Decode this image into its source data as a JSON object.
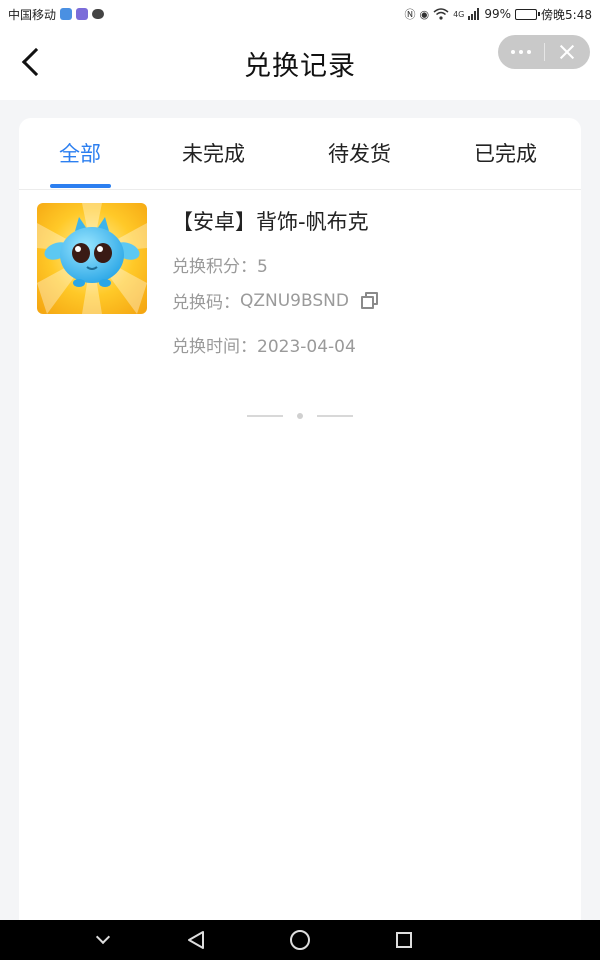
{
  "status_bar": {
    "carrier": "中国移动",
    "battery": "99%",
    "battery_level": 0.99,
    "time": "傍晚5:48",
    "network": "4G",
    "icons": [
      "app-notification-icon",
      "app-notification-icon",
      "chat-icon",
      "nfc-icon",
      "eye-icon",
      "wifi-icon",
      "signal-icon",
      "battery-icon"
    ],
    "colors": {
      "app_icon_1": "#4a90e2",
      "app_icon_2": "#7b6cd9",
      "battery_fill": "#2bb34a"
    }
  },
  "header": {
    "title": "兑换记录",
    "back_icon": "chevron-left-icon",
    "capsule": {
      "more_icon": "more-dots-icon",
      "close_icon": "close-icon"
    }
  },
  "tabs": [
    {
      "label": "全部",
      "active": true
    },
    {
      "label": "未完成",
      "active": false
    },
    {
      "label": "待发货",
      "active": false
    },
    {
      "label": "已完成",
      "active": false
    }
  ],
  "accent_color": "#2c7ff0",
  "records": [
    {
      "title": "【安卓】背饰-帆布克",
      "points_label": "兑换积分：",
      "points_value": "5",
      "code_label": "兑换码：",
      "code_value": "QZNU9BSND",
      "time_label": "兑换时间：",
      "time_value": "2023-04-04",
      "image": "blue-creature-item-image"
    }
  ],
  "nav_bar": {
    "icons": [
      "hide-keyboard-icon",
      "back-triangle-icon",
      "home-circle-icon",
      "recents-square-icon"
    ]
  }
}
